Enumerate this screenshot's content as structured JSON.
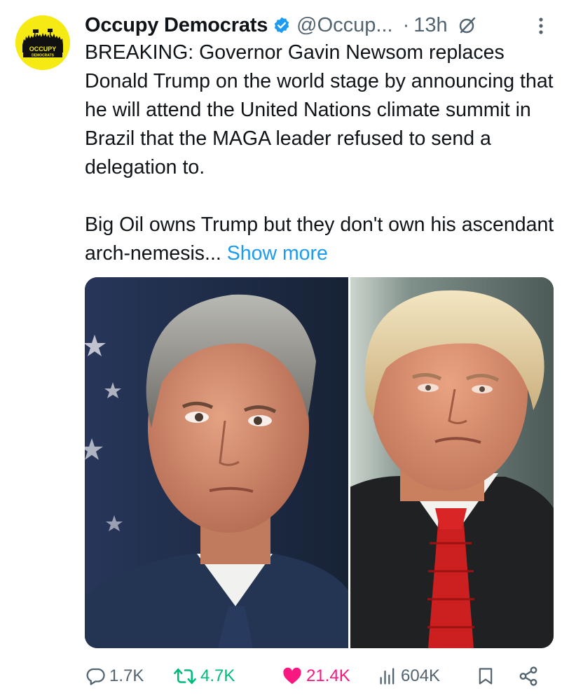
{
  "author": {
    "display_name": "Occupy Democrats",
    "handle": "@Occup...",
    "separator": "·",
    "time": "13h",
    "avatar_text_top": "OCCUPY",
    "avatar_text_bottom": "DEMOCRATS",
    "avatar_color": "#f6ea14"
  },
  "tweet": {
    "paragraph1": "BREAKING: Governor Gavin Newsom replaces Donald Trump on the world stage by announcing that he will attend the United Nations climate summit in Brazil that the MAGA leader refused to send a delegation to.",
    "paragraph2": "Big Oil owns Trump but they don't own his ascendant arch-nemesis...",
    "show_more": "Show more"
  },
  "metrics": {
    "replies": "1.7K",
    "reposts": "4.7K",
    "likes": "21.4K",
    "views": "604K"
  },
  "colors": {
    "link": "#1d9bf0",
    "muted": "#536471",
    "repost_active": "#00ba7c",
    "like_active": "#f91880",
    "verified": "#1d9bf0"
  },
  "icons": [
    "verified-badge-icon",
    "grok-icon",
    "more-options-icon",
    "reply-icon",
    "repost-icon",
    "like-icon",
    "views-icon",
    "bookmark-icon",
    "share-icon"
  ]
}
